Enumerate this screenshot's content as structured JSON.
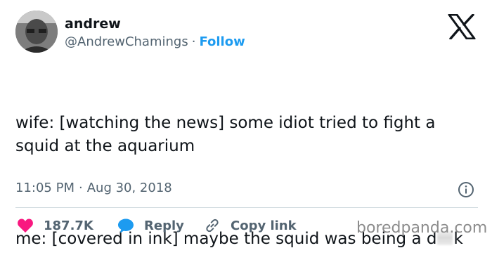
{
  "author": {
    "name": "andrew",
    "handle": "@AndrewChamings",
    "separator": "·",
    "follow_label": "Follow"
  },
  "tweet": {
    "line1": "wife: [watching the news] some idiot tried to fight a squid at the aquarium",
    "line2_before": "me: [covered in ink] maybe the squid was being a d",
    "line2_after": "k"
  },
  "meta": {
    "time": "11:05 PM",
    "separator": "·",
    "date": "Aug 30, 2018"
  },
  "actions": {
    "likes": "187.7K",
    "reply_label": "Reply",
    "copy_label": "Copy link"
  },
  "watermark": "boredpanda.com",
  "colors": {
    "link_blue": "#1d9bf0",
    "heart_red": "#f91880",
    "reply_blue": "#1d9bf0",
    "muted_gray": "#536471"
  },
  "icons": [
    "x-logo-icon",
    "info-icon",
    "heart-icon",
    "reply-bubble-icon",
    "link-icon"
  ]
}
